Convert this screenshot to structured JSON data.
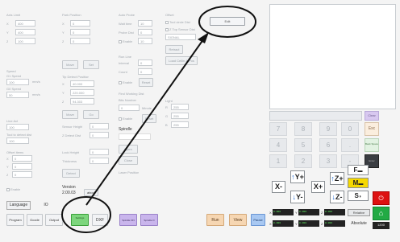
{
  "form": {
    "axis_limit": {
      "title": "Axis Limit",
      "x": "400",
      "y": "400",
      "z": "100"
    },
    "park": {
      "title": "Park Position",
      "x": "0",
      "y": "0",
      "z": "0"
    },
    "auto_probe": {
      "title": "Auto Probe",
      "wait": "Wait time",
      "wait_val": "10",
      "probe_dist": "Probe Dist",
      "probe_val": "0",
      "enable": "Enable",
      "enable_val": "10"
    },
    "offset": {
      "title": "Offset",
      "tool_circle": "Tool circle Dist",
      "top_sensor": "Z Top Sensor Dist",
      "signal": "SIGNAL"
    },
    "speed": {
      "title": "Speed",
      "g1": "G1 Speed",
      "g1_val": "100",
      "g0": "G0 Speed",
      "g0_val": "50",
      "unit": "mm/s"
    },
    "mid_buttons": {
      "move": "Move",
      "set": "Set"
    },
    "tool_sensor": {
      "title": "Tip Detect Position",
      "x": "40.000",
      "y": "220.000",
      "z": "94.303"
    },
    "run_line": {
      "title": "Run Line",
      "interval": "Interval",
      "interval_val": "0",
      "count": "Count",
      "count_val": "0",
      "enable": "Enable",
      "reset": "Reset"
    },
    "light": {
      "title": "Light",
      "r": "R",
      "g": "G",
      "b": "B",
      "r_val": "255",
      "g_val": "255",
      "b_val": "255"
    },
    "extra": {
      "a": "Retract",
      "b": "Load Cellin & Pos"
    },
    "line_act": {
      "title": "Line Act",
      "val": "100",
      "tool": "Tool to detect dist",
      "tool_val": "100"
    },
    "sensor_height": {
      "label": "Sensor Height",
      "val": "0",
      "reach": "Z Detect Dist",
      "reach_val": "0",
      "move": "Move",
      "go": "Go"
    },
    "find_working": {
      "label": "Find Working Dist",
      "sub": "Bits Number",
      "sub_val": "0",
      "unit": "Minute",
      "enable": "Enable",
      "reset": "Reset"
    },
    "spindle": {
      "title": "Spindle",
      "open": "Open",
      "close": "Close"
    },
    "offset_items": {
      "title": "Offset items",
      "x": "0",
      "y": "0",
      "z": "0"
    },
    "lock": {
      "label": "Lock Height",
      "val": "0",
      "thickness": "Thickness",
      "thick_val": "0",
      "detect": "Detect"
    },
    "laser": {
      "label": "Laser Position"
    },
    "enable_bottom": "Enable",
    "version": {
      "label": "Version",
      "val": "2.00.03",
      "about": "about"
    },
    "edit_button": "Edit"
  },
  "left_bottom": {
    "language": "Language",
    "io": "IO"
  },
  "keypad": {
    "clear": "Clear",
    "esc": "Esc",
    "back": "Back Space",
    "enter": "Enter",
    "keys": [
      "7",
      "8",
      "9",
      "0",
      "4",
      "5",
      "6",
      ".",
      "1",
      "2",
      "3",
      "-"
    ]
  },
  "jog": {
    "x_minus": "X-",
    "x_plus": "X+",
    "y_plus": "Y+",
    "y_minus": "Y-",
    "z_plus": "Z+",
    "z_minus": "Z-",
    "fast": "F",
    "mid": "M",
    "slow": "S"
  },
  "dro": {
    "x": "0.000",
    "y": "0.000",
    "z": "0.000",
    "wx": "0.000",
    "wy": "0.000",
    "wz": "0.000",
    "rel": "Relative",
    "abs": "Absolute",
    "labels": [
      "X",
      "Y",
      "Z"
    ],
    "value": "1200"
  },
  "toolbar": {
    "program": "Program",
    "gcode": "Gcode",
    "output": "Output",
    "settings": "Settings",
    "dxf": "DXF",
    "spindle_on": "Spindle ON",
    "spindle_off": "Spindle O",
    "run": "Run",
    "view": "View",
    "pause": "Pause"
  },
  "colors": {
    "accent_red": "#dd1111",
    "accent_green": "#22aa44",
    "gold": "#f5d800"
  }
}
